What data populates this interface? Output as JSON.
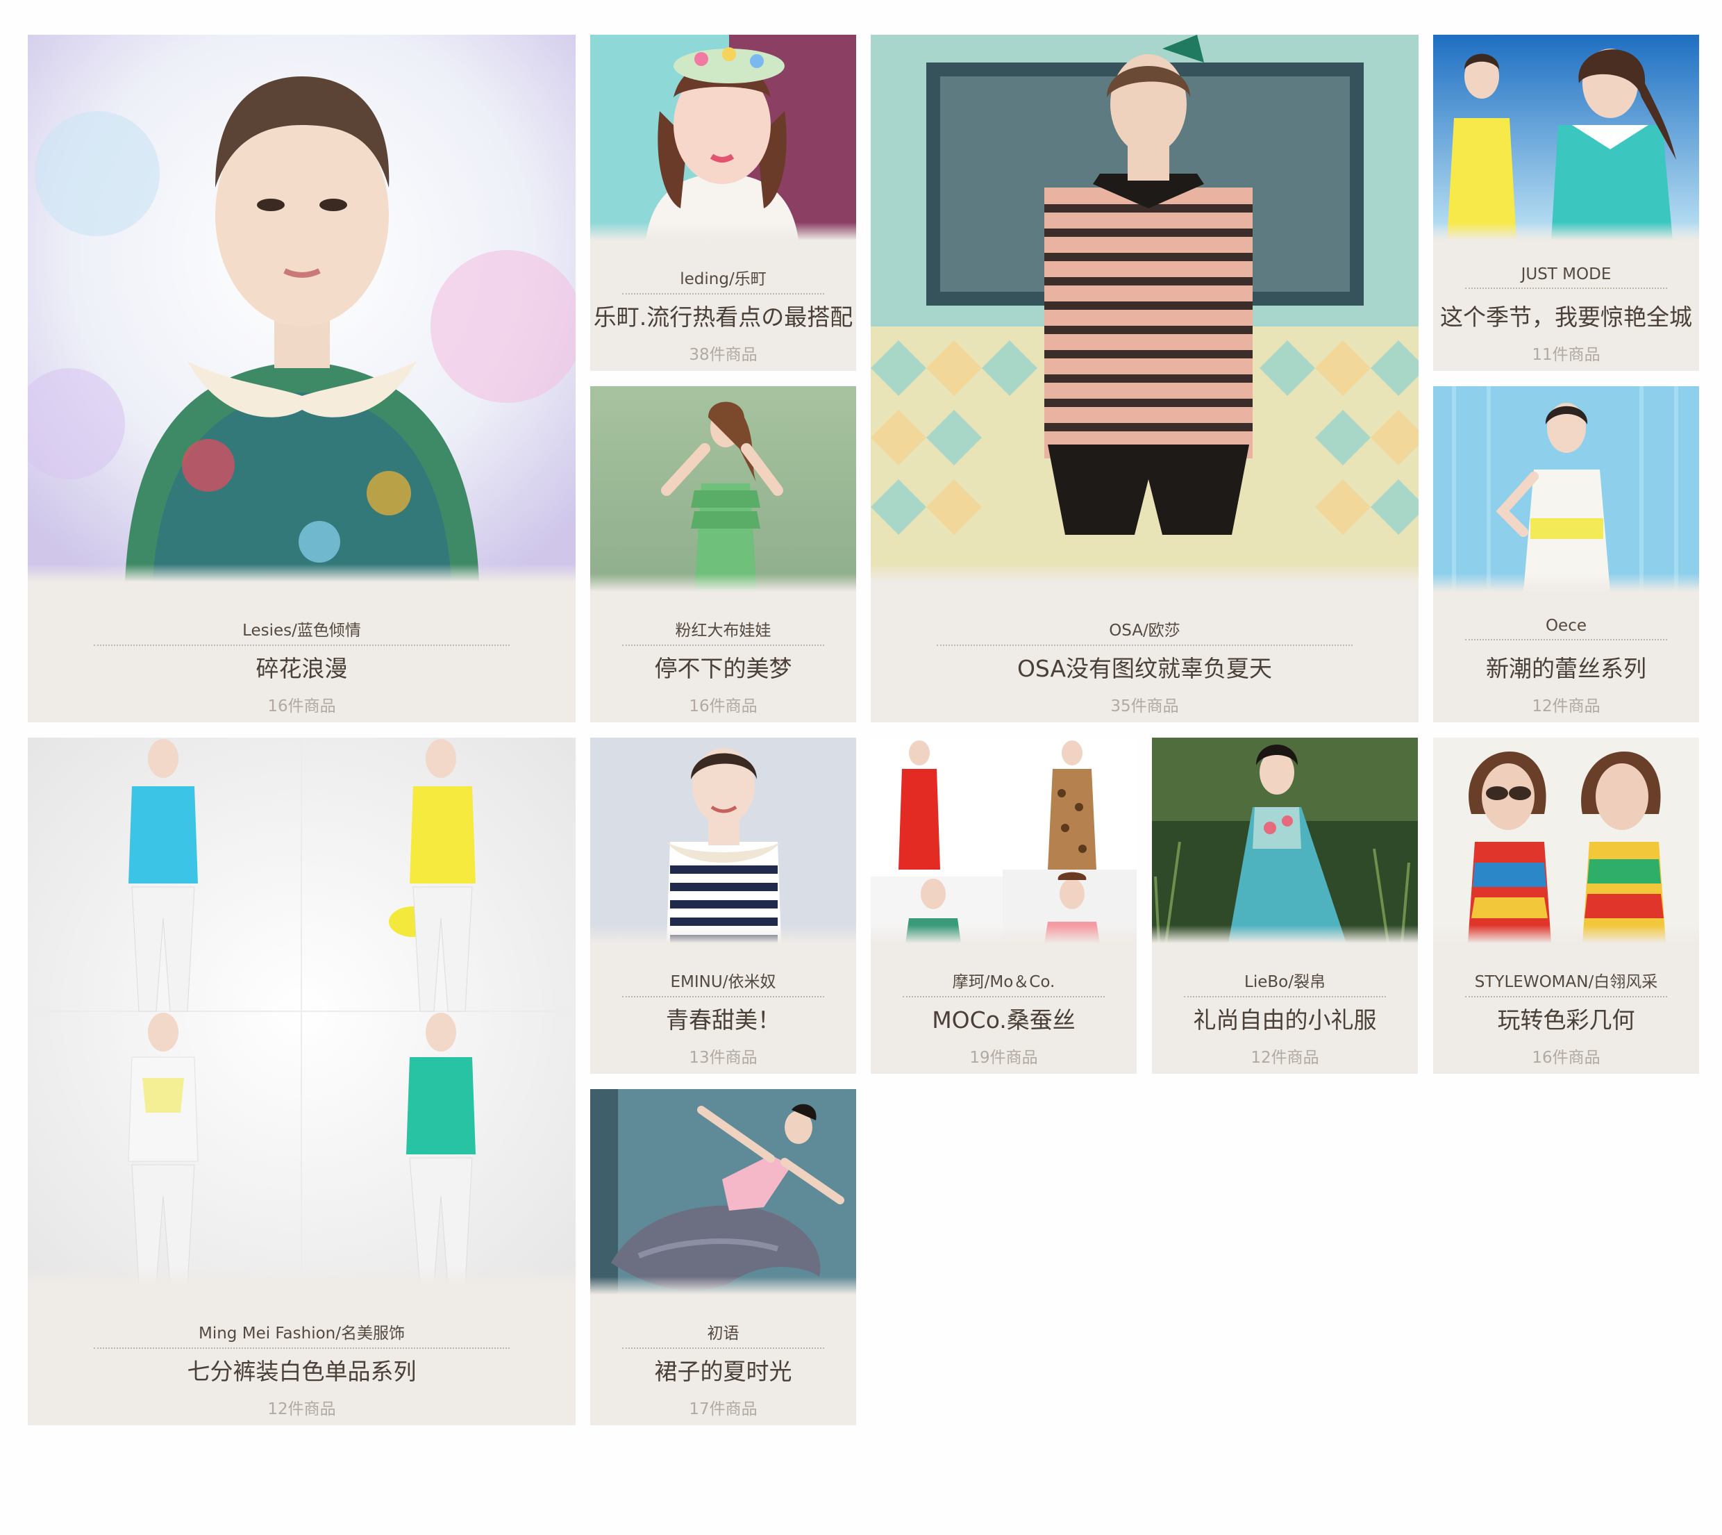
{
  "cards": [
    {
      "brand": "Lesies/蓝色倾情",
      "title": "碎花浪漫",
      "count": "16件商品"
    },
    {
      "brand": "leding/乐町",
      "title": "乐町.流行热看点の最搭配",
      "count": "38件商品"
    },
    {
      "brand": "粉红大布娃娃",
      "title": "停不下的美梦",
      "count": "16件商品"
    },
    {
      "brand": "OSA/欧莎",
      "title": "OSA没有图纹就辜负夏天",
      "count": "35件商品"
    },
    {
      "brand": "JUST MODE",
      "title": "这个季节，我要惊艳全城",
      "count": "11件商品"
    },
    {
      "brand": "Oece",
      "title": "新潮的蕾丝系列",
      "count": "12件商品"
    },
    {
      "brand": "Ming Mei Fashion/名美服饰",
      "title": "七分裤装白色单品系列",
      "count": "12件商品"
    },
    {
      "brand": "EMINU/依米奴",
      "title": "青春甜美！",
      "count": "13件商品"
    },
    {
      "brand": "摩珂/Mo＆Co.",
      "title": "MOCo.桑蚕丝",
      "count": "19件商品"
    },
    {
      "brand": "LieBo/裂帛",
      "title": "礼尚自由的小礼服",
      "count": "12件商品"
    },
    {
      "brand": "STYLEWOMAN/白翎风采",
      "title": "玩转色彩几何",
      "count": "16件商品"
    },
    {
      "brand": "初语",
      "title": "裙子的夏时光",
      "count": "17件商品"
    }
  ]
}
